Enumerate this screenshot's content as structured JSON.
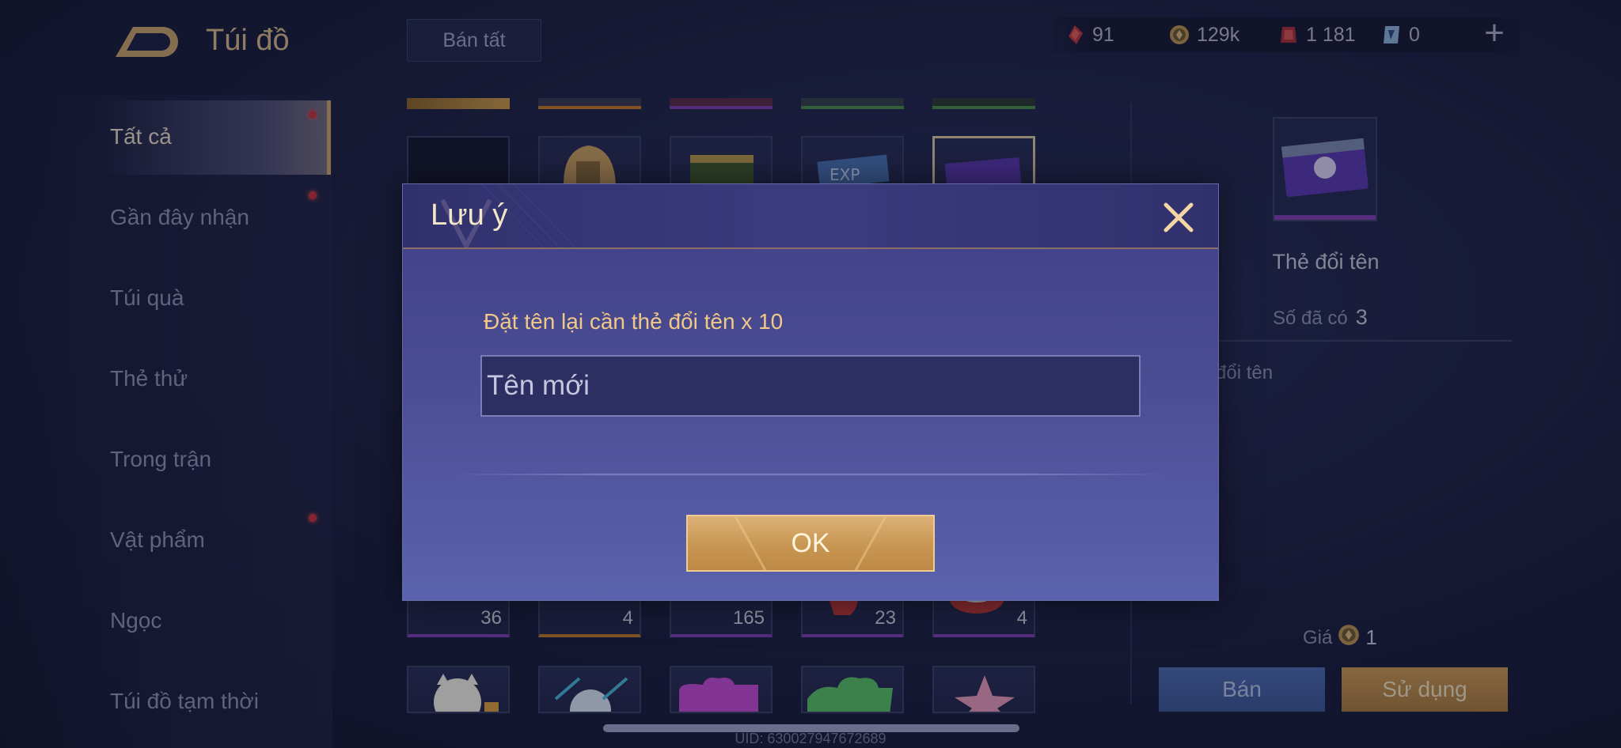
{
  "header": {
    "title": "Túi đồ",
    "sell_all_label": "Bán tất"
  },
  "currencies": [
    {
      "icon": "red-crystal-icon",
      "value": "91"
    },
    {
      "icon": "gold-coin-icon",
      "value": "129k"
    },
    {
      "icon": "red-voucher-icon",
      "value": "1 181"
    },
    {
      "icon": "blue-ticket-icon",
      "value": "0"
    }
  ],
  "sidebar": {
    "items": [
      {
        "label": "Tất cả",
        "active": true,
        "dot": true
      },
      {
        "label": "Gần đây nhận",
        "dot": true
      },
      {
        "label": "Túi quà"
      },
      {
        "label": "Thẻ thử"
      },
      {
        "label": "Trong trận"
      },
      {
        "label": "Vật phẩm",
        "dot": true
      },
      {
        "label": "Ngọc"
      },
      {
        "label": "Túi đồ tạm thời"
      }
    ]
  },
  "grid": {
    "counts": [
      "36",
      "4",
      "165",
      "23",
      "4"
    ]
  },
  "detail": {
    "item_name": "Thẻ đổi tên",
    "owned_label": "Số đã có",
    "owned_value": "3",
    "description_fragment": "đổi tên",
    "price_label": "Giá",
    "price_value": "1",
    "sell_label": "Bán",
    "use_label": "Sử dụng"
  },
  "modal": {
    "title": "Lưu ý",
    "message": "Đặt tên lại cần thẻ đổi tên x 10",
    "input_placeholder": "Tên mới",
    "input_value": "",
    "ok_label": "OK"
  },
  "footer": {
    "uid": "UID: 630027947672689"
  },
  "colors": {
    "accent_gold": "#d7b98a",
    "modal_bg": "#4a4c92",
    "ok_button": "#c89652",
    "sell_button": "#3a5593"
  }
}
